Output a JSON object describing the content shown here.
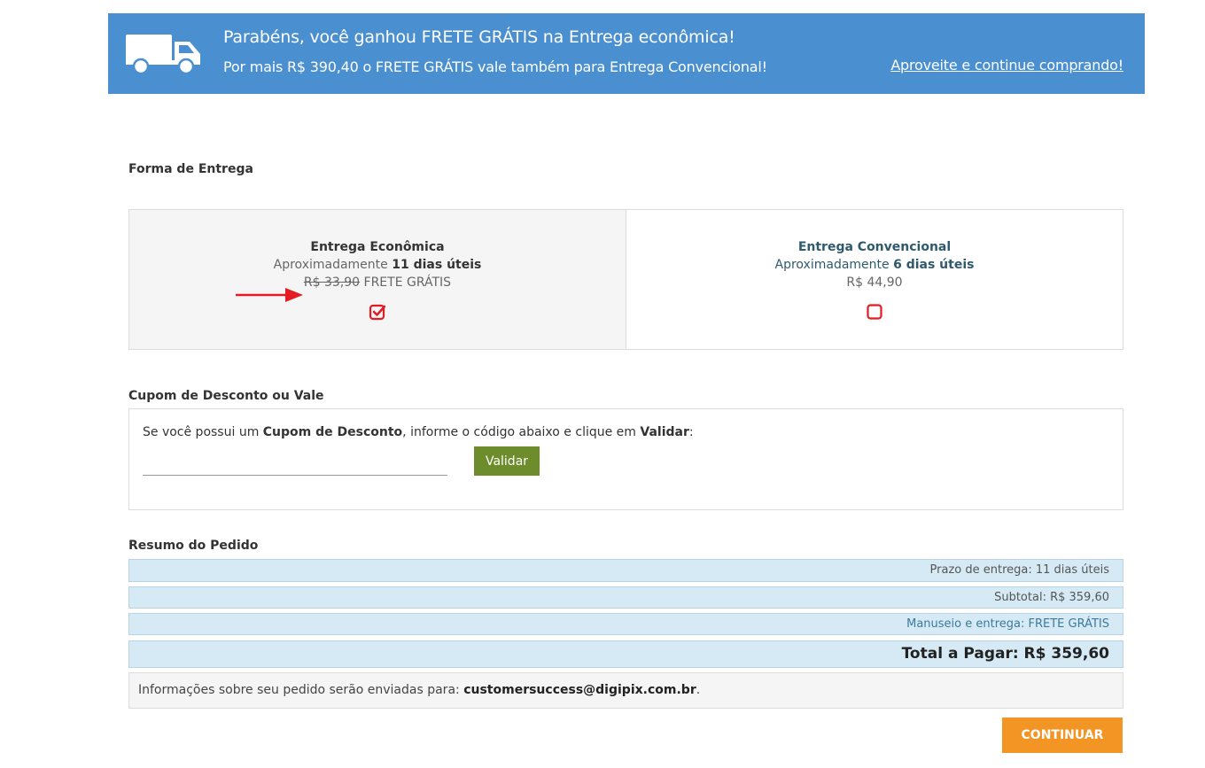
{
  "banner": {
    "line1": "Parabéns, você ganhou FRETE GRÁTIS na Entrega econômica!",
    "line2": "Por mais R$ 390,40 o FRETE GRÁTIS vale também para Entrega Convencional!",
    "link": "Aproveite e continue comprando!"
  },
  "shipping": {
    "title": "Forma de Entrega",
    "options": [
      {
        "name": "Entrega Econômica",
        "approx_label": "Aproximadamente",
        "days": "11 dias úteis",
        "old_price": "R$ 33,90",
        "price": "FRETE GRÁTIS",
        "checked": true
      },
      {
        "name": "Entrega Convencional",
        "approx_label": "Aproximadamente",
        "days": "6 dias úteis",
        "price": "R$ 44,90",
        "checked": false
      }
    ]
  },
  "coupon": {
    "title": "Cupom de Desconto ou Vale",
    "text_pre": "Se você possui um",
    "text_bold1": "Cupom de Desconto",
    "text_mid": ", informe o código abaixo e clique em",
    "text_bold2": "Validar",
    "text_end": ":",
    "input_value": "",
    "button_label": "Validar"
  },
  "summary": {
    "title": "Resumo do Pedido",
    "delivery_time": "Prazo de entrega: 11 dias úteis",
    "subtotal": "Subtotal: R$ 359,60",
    "handling": "Manuseio e entrega: FRETE GRÁTIS",
    "total": "Total a Pagar: R$ 359,60"
  },
  "info": {
    "text": "Informações sobre seu pedido serão enviadas para:",
    "email": "customersuccess@digipix.com.br",
    "end": "."
  },
  "continue_label": "CONTINUAR",
  "colors": {
    "banner": "#4a8fd0",
    "check": "#e31b23",
    "validate": "#6d8c2b",
    "continue": "#f39525",
    "summary_bg": "#d6eaf5"
  }
}
